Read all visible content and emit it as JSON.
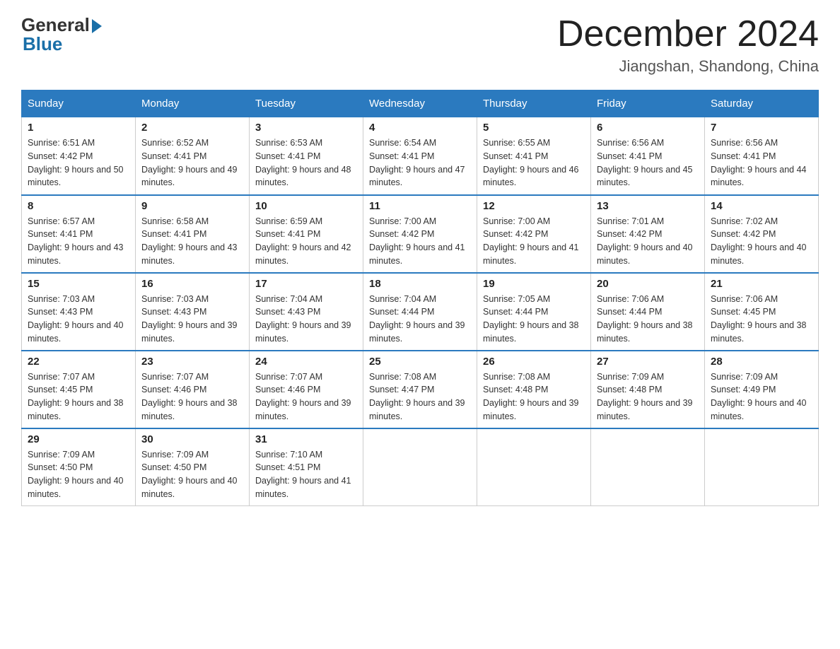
{
  "logo": {
    "general": "General",
    "blue": "Blue"
  },
  "title": "December 2024",
  "location": "Jiangshan, Shandong, China",
  "days_header": [
    "Sunday",
    "Monday",
    "Tuesday",
    "Wednesday",
    "Thursday",
    "Friday",
    "Saturday"
  ],
  "weeks": [
    [
      {
        "day": "1",
        "sunrise": "6:51 AM",
        "sunset": "4:42 PM",
        "daylight": "9 hours and 50 minutes."
      },
      {
        "day": "2",
        "sunrise": "6:52 AM",
        "sunset": "4:41 PM",
        "daylight": "9 hours and 49 minutes."
      },
      {
        "day": "3",
        "sunrise": "6:53 AM",
        "sunset": "4:41 PM",
        "daylight": "9 hours and 48 minutes."
      },
      {
        "day": "4",
        "sunrise": "6:54 AM",
        "sunset": "4:41 PM",
        "daylight": "9 hours and 47 minutes."
      },
      {
        "day": "5",
        "sunrise": "6:55 AM",
        "sunset": "4:41 PM",
        "daylight": "9 hours and 46 minutes."
      },
      {
        "day": "6",
        "sunrise": "6:56 AM",
        "sunset": "4:41 PM",
        "daylight": "9 hours and 45 minutes."
      },
      {
        "day": "7",
        "sunrise": "6:56 AM",
        "sunset": "4:41 PM",
        "daylight": "9 hours and 44 minutes."
      }
    ],
    [
      {
        "day": "8",
        "sunrise": "6:57 AM",
        "sunset": "4:41 PM",
        "daylight": "9 hours and 43 minutes."
      },
      {
        "day": "9",
        "sunrise": "6:58 AM",
        "sunset": "4:41 PM",
        "daylight": "9 hours and 43 minutes."
      },
      {
        "day": "10",
        "sunrise": "6:59 AM",
        "sunset": "4:41 PM",
        "daylight": "9 hours and 42 minutes."
      },
      {
        "day": "11",
        "sunrise": "7:00 AM",
        "sunset": "4:42 PM",
        "daylight": "9 hours and 41 minutes."
      },
      {
        "day": "12",
        "sunrise": "7:00 AM",
        "sunset": "4:42 PM",
        "daylight": "9 hours and 41 minutes."
      },
      {
        "day": "13",
        "sunrise": "7:01 AM",
        "sunset": "4:42 PM",
        "daylight": "9 hours and 40 minutes."
      },
      {
        "day": "14",
        "sunrise": "7:02 AM",
        "sunset": "4:42 PM",
        "daylight": "9 hours and 40 minutes."
      }
    ],
    [
      {
        "day": "15",
        "sunrise": "7:03 AM",
        "sunset": "4:43 PM",
        "daylight": "9 hours and 40 minutes."
      },
      {
        "day": "16",
        "sunrise": "7:03 AM",
        "sunset": "4:43 PM",
        "daylight": "9 hours and 39 minutes."
      },
      {
        "day": "17",
        "sunrise": "7:04 AM",
        "sunset": "4:43 PM",
        "daylight": "9 hours and 39 minutes."
      },
      {
        "day": "18",
        "sunrise": "7:04 AM",
        "sunset": "4:44 PM",
        "daylight": "9 hours and 39 minutes."
      },
      {
        "day": "19",
        "sunrise": "7:05 AM",
        "sunset": "4:44 PM",
        "daylight": "9 hours and 38 minutes."
      },
      {
        "day": "20",
        "sunrise": "7:06 AM",
        "sunset": "4:44 PM",
        "daylight": "9 hours and 38 minutes."
      },
      {
        "day": "21",
        "sunrise": "7:06 AM",
        "sunset": "4:45 PM",
        "daylight": "9 hours and 38 minutes."
      }
    ],
    [
      {
        "day": "22",
        "sunrise": "7:07 AM",
        "sunset": "4:45 PM",
        "daylight": "9 hours and 38 minutes."
      },
      {
        "day": "23",
        "sunrise": "7:07 AM",
        "sunset": "4:46 PM",
        "daylight": "9 hours and 38 minutes."
      },
      {
        "day": "24",
        "sunrise": "7:07 AM",
        "sunset": "4:46 PM",
        "daylight": "9 hours and 39 minutes."
      },
      {
        "day": "25",
        "sunrise": "7:08 AM",
        "sunset": "4:47 PM",
        "daylight": "9 hours and 39 minutes."
      },
      {
        "day": "26",
        "sunrise": "7:08 AM",
        "sunset": "4:48 PM",
        "daylight": "9 hours and 39 minutes."
      },
      {
        "day": "27",
        "sunrise": "7:09 AM",
        "sunset": "4:48 PM",
        "daylight": "9 hours and 39 minutes."
      },
      {
        "day": "28",
        "sunrise": "7:09 AM",
        "sunset": "4:49 PM",
        "daylight": "9 hours and 40 minutes."
      }
    ],
    [
      {
        "day": "29",
        "sunrise": "7:09 AM",
        "sunset": "4:50 PM",
        "daylight": "9 hours and 40 minutes."
      },
      {
        "day": "30",
        "sunrise": "7:09 AM",
        "sunset": "4:50 PM",
        "daylight": "9 hours and 40 minutes."
      },
      {
        "day": "31",
        "sunrise": "7:10 AM",
        "sunset": "4:51 PM",
        "daylight": "9 hours and 41 minutes."
      },
      null,
      null,
      null,
      null
    ]
  ]
}
